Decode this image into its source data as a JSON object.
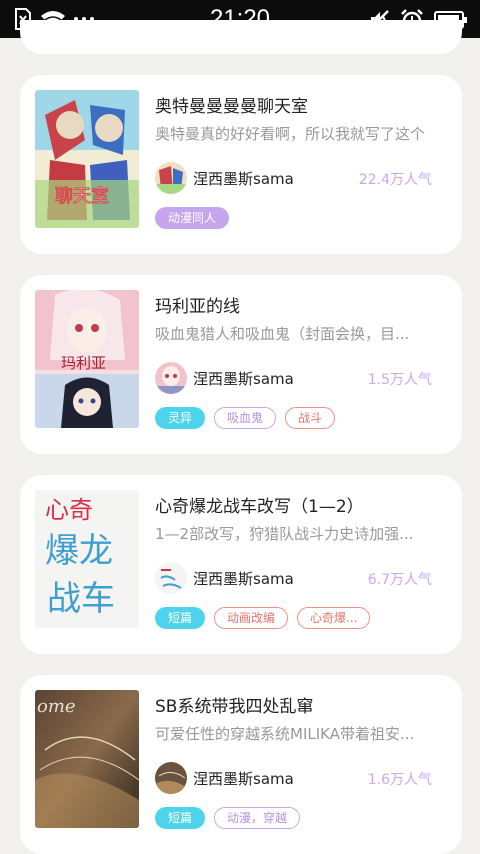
{
  "status_bar": {
    "time": "21:20",
    "icons": [
      "sim-icon",
      "wifi-icon",
      "more-dots-icon",
      "mute-icon",
      "alarm-icon",
      "battery-icon"
    ]
  },
  "colors": {
    "popularity": "#c9a8ee",
    "tag_purple": "#c5a6ee",
    "tag_cyan": "#4dd3ec",
    "tag_red": "#ee8f86",
    "background": "#f1f0ec"
  },
  "cards": [
    {
      "title": "奥特曼曼曼曼聊天室",
      "desc": "奥特曼真的好好看啊，所以我就写了这个",
      "author": "涅西墨斯sama",
      "popularity": "22.4万人气",
      "cover_text": "聊天室",
      "tags": [
        {
          "label": "动漫同人",
          "style": "fill-purple"
        }
      ]
    },
    {
      "title": "玛利亚的线",
      "desc": "吸血鬼猎人和吸血鬼（封面会换，目...",
      "author": "涅西墨斯sama",
      "popularity": "1.5万人气",
      "cover_text": "玛利亚",
      "tags": [
        {
          "label": "灵异",
          "style": "fill-cyan"
        },
        {
          "label": "吸血鬼",
          "style": "out-purple"
        },
        {
          "label": "战斗",
          "style": "out-red"
        }
      ]
    },
    {
      "title": "心奇爆龙战车改写（1—2）",
      "desc": "1—2部改写，狩猎队战斗力史诗加强...",
      "author": "涅西墨斯sama",
      "popularity": "6.7万人气",
      "cover_text_1": "心奇",
      "cover_text_2": "爆龙",
      "cover_text_3": "战车",
      "tags": [
        {
          "label": "短篇",
          "style": "fill-cyan"
        },
        {
          "label": "动画改编",
          "style": "out-red"
        },
        {
          "label": "心奇爆...",
          "style": "out-red"
        }
      ]
    },
    {
      "title": "SB系统带我四处乱窜",
      "desc": "可爱任性的穿越系统MILIKA带着祖安...",
      "author": "涅西墨斯sama",
      "popularity": "1.6万人气",
      "cover_text": "ome",
      "tags": [
        {
          "label": "短篇",
          "style": "fill-cyan"
        },
        {
          "label": "动漫，穿越",
          "style": "out-purple"
        }
      ]
    }
  ]
}
